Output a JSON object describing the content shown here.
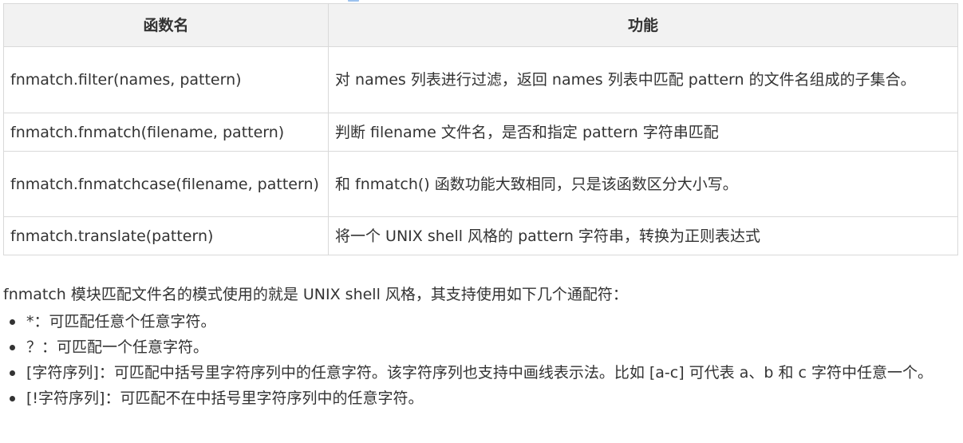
{
  "table": {
    "headers": [
      "函数名",
      "功能"
    ],
    "rows": [
      {
        "name": "fnmatch.filter(names, pattern)",
        "desc": "对 names 列表进行过滤，返回 names 列表中匹配 pattern 的文件名组成的子集合。"
      },
      {
        "name": "fnmatch.fnmatch(filename, pattern)",
        "desc": "判断 filename 文件名，是否和指定 pattern 字符串匹配"
      },
      {
        "name": "fnmatch.fnmatchcase(filename, pattern)",
        "desc": "和 fnmatch() 函数功能大致相同，只是该函数区分大小写。"
      },
      {
        "name": "fnmatch.translate(pattern)",
        "desc": "将一个 UNIX shell 风格的 pattern 字符串，转换为正则表达式"
      }
    ]
  },
  "intro": "fnmatch 模块匹配文件名的模式使用的就是 UNIX shell 风格，其支持使用如下几个通配符：",
  "bullets": [
    "*：可匹配任意个任意字符。",
    "？：可匹配一个任意字符。",
    "[字符序列]：可匹配中括号里字符序列中的任意字符。该字符序列也支持中画线表示法。比如 [a-c] 可代表 a、b 和 c 字符中任意一个。",
    "[!字符序列]：可匹配不在中括号里字符序列中的任意字符。"
  ]
}
